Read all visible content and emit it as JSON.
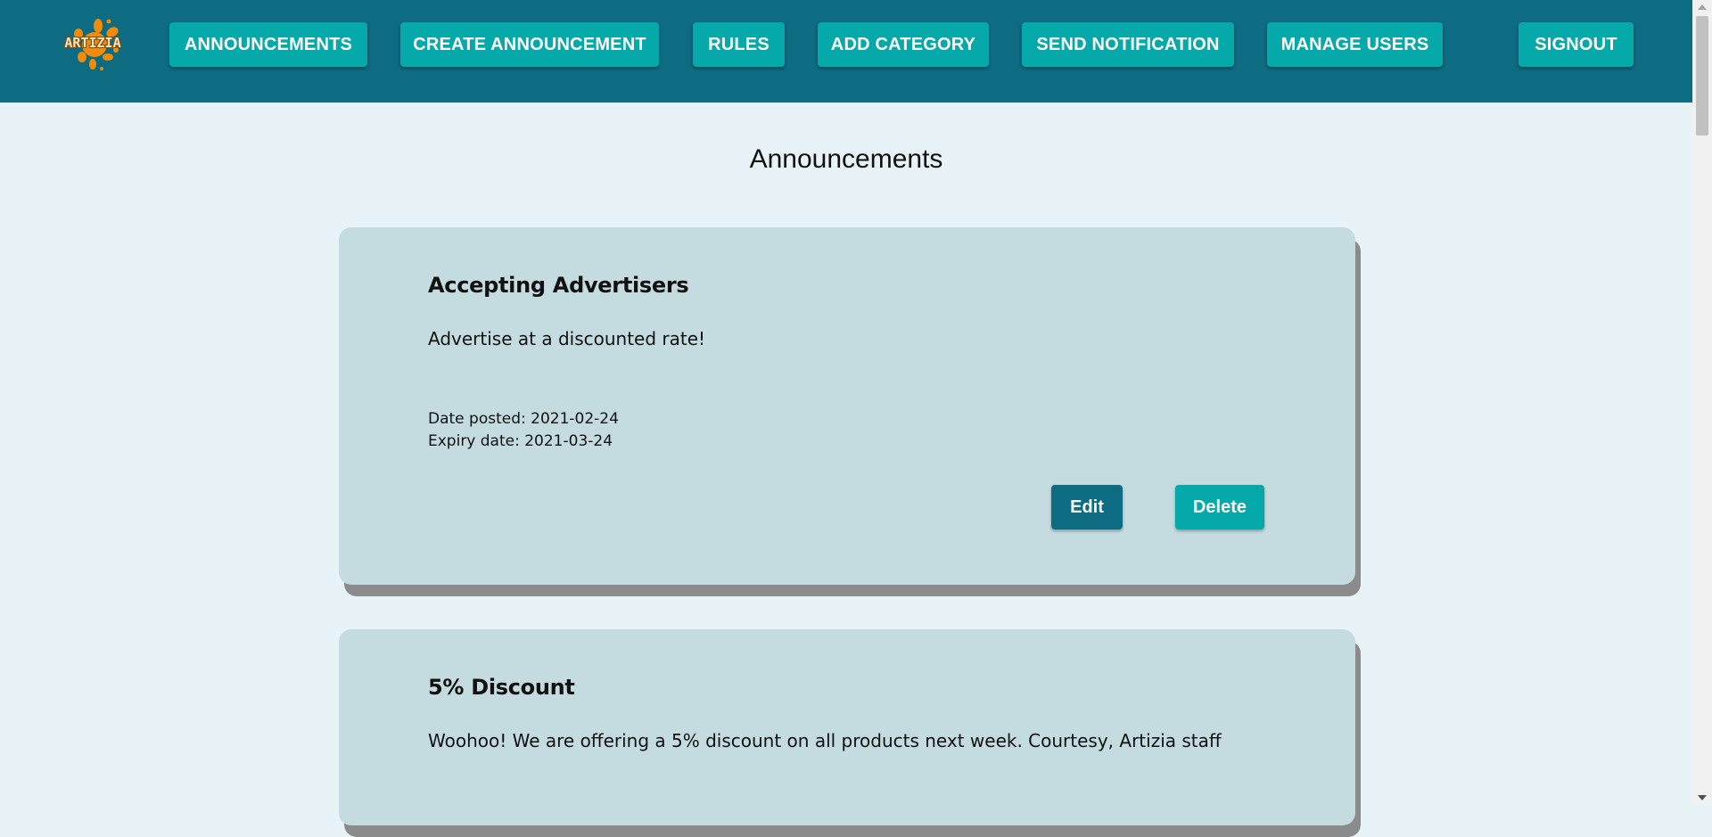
{
  "app": {
    "logo_text": "ARTIZIA",
    "brand_color": "#0d6b82",
    "accent_color": "#05a9a9"
  },
  "nav": {
    "announcements": "ANNOUNCEMENTS",
    "create_announcement": "CREATE ANNOUNCEMENT",
    "rules": "RULES",
    "add_category": "ADD CATEGORY",
    "send_notification": "SEND NOTIFICATION",
    "manage_users": "MANAGE USERS",
    "signout": "SIGNOUT"
  },
  "page": {
    "title": "Announcements"
  },
  "announcements": [
    {
      "title": "Accepting Advertisers",
      "body": "Advertise at a discounted rate!",
      "date_posted": "Date posted: 2021-02-24",
      "expiry_date": "Expiry date: 2021-03-24",
      "edit_label": "Edit",
      "delete_label": "Delete"
    },
    {
      "title": "5% Discount",
      "body": "Woohoo! We are offering a 5% discount on all products next week. Courtesy, Artizia staff"
    }
  ]
}
